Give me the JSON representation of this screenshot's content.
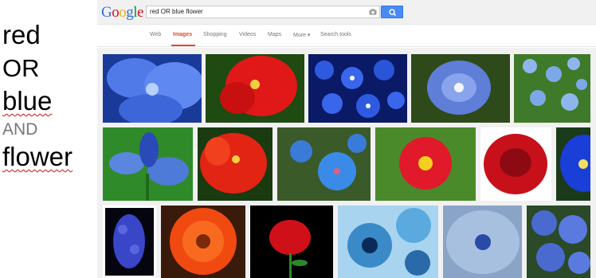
{
  "slide": {
    "words": [
      "red",
      "OR",
      "blue",
      "AND",
      "flower"
    ]
  },
  "google": {
    "logo": [
      "G",
      "o",
      "o",
      "g",
      "l",
      "e"
    ],
    "logo_colors": [
      "#3369e8",
      "#d50f25",
      "#eeb211",
      "#3369e8",
      "#009925",
      "#d50f25"
    ],
    "query": "red OR blue flower",
    "nav": [
      "Web",
      "Images",
      "Shopping",
      "Videos",
      "Maps",
      "More ▾",
      "Search tools"
    ],
    "active_tab": "Images",
    "accent": "#dd4b39",
    "button_color": "#4a8af4"
  },
  "results": {
    "rows": [
      [
        "blue-lily",
        "red-hibiscus",
        "blue-small-flowers",
        "blue-morning-glory",
        "blue-forget-me-not"
      ],
      [
        "blue-iris",
        "red-hibiscus-2",
        "blue-star-flowers",
        "red-cosmos",
        "red-rose-bloom",
        "blue-flower-partial"
      ],
      [
        "blue-hyacinth",
        "orange-gerbera",
        "red-rose-black",
        "blue-flower-art",
        "blue-flower-closeup",
        "blue-hydrangea"
      ]
    ]
  }
}
